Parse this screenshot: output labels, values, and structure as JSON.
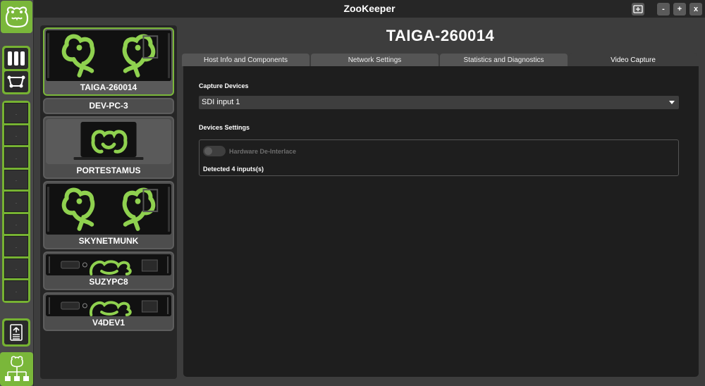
{
  "app": {
    "title": "ZooKeeper"
  },
  "window_controls": {
    "screenshot_icon": "screen-capture-icon",
    "minimize": "-",
    "maximize": "+",
    "close": "x"
  },
  "rail": {
    "logo_icon": "frog-logo-icon",
    "view_icons": [
      "columns-view-icon",
      "node-graph-icon"
    ],
    "slots": [
      ".",
      ".",
      ".",
      ".",
      ".",
      ".",
      ".",
      ".",
      "."
    ],
    "upload_icon": "upload-document-icon",
    "network_icon": "network-tree-icon"
  },
  "devices": [
    {
      "name": "TAIGA-260014",
      "kind": "server",
      "selected": true
    },
    {
      "name": "DEV-PC-3",
      "kind": "none",
      "selected": false
    },
    {
      "name": "PORTESTAMUS",
      "kind": "laptop",
      "selected": false
    },
    {
      "name": "SKYNETMUNK",
      "kind": "server",
      "selected": false
    },
    {
      "name": "SUZYPC8",
      "kind": "rack",
      "selected": false
    },
    {
      "name": "V4DEV1",
      "kind": "rack",
      "selected": false
    }
  ],
  "main": {
    "host_title": "TAIGA-260014",
    "tabs": [
      {
        "label": "Host Info and Components",
        "active": false
      },
      {
        "label": "Network Settings",
        "active": false
      },
      {
        "label": "Statistics and Diagnostics",
        "active": false
      },
      {
        "label": "Video Capture",
        "active": true
      }
    ],
    "capture_devices_title": "Capture Devices",
    "capture_select_value": "SDI input 1",
    "devices_settings_title": "Devices Settings",
    "deinterlace_label": "Hardware De-Interlace",
    "deinterlace_on": false,
    "detected_text": "Detected 4 inputs(s)"
  },
  "colors": {
    "accent": "#7ab73a",
    "panel": "#262626",
    "content": "#1e1e1e"
  }
}
